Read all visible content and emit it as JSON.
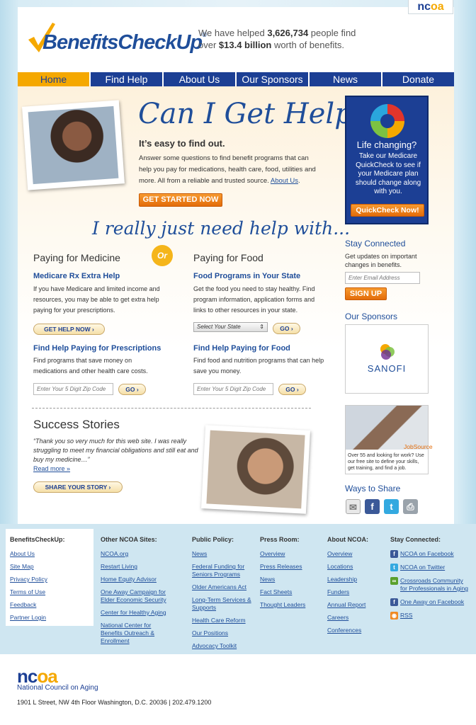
{
  "header": {
    "ncoa_tab": {
      "nc": "nc",
      "oa": "oa"
    },
    "logo_text": "BenefitsCheckUp",
    "logo_reg": "®",
    "helped": {
      "pre": "We have helped ",
      "people": "3,626,734",
      "mid": " people find",
      "line2_pre": "over ",
      "amount": "$13.4 billion",
      "post": " worth of benefits."
    }
  },
  "nav": {
    "items": [
      "Home",
      "Find Help",
      "About Us",
      "Our Sponsors",
      "News",
      "Donate"
    ]
  },
  "hero": {
    "headline": "Can I Get Help?",
    "easy": "It’s easy to find out.",
    "text": "Answer some questions to find benefit programs that can help you pay for medications, health care, food, utilities and more. All from a reliable and trusted source.",
    "about_link": "About Us",
    "cta": "GET STARTED NOW"
  },
  "help": {
    "heading": "I really just need help with...",
    "or": "Or",
    "medicine": {
      "title": "Paying for Medicine",
      "extra_help_title": "Medicare Rx Extra Help",
      "extra_help_text": "If you have Medicare and limited income and resources, you may be able to get extra help paying for your prescriptions.",
      "extra_help_btn": "GET HELP NOW ›",
      "rx_title": "Find Help Paying for Prescriptions",
      "rx_text": "Find programs that save money on medications and other health care costs.",
      "zip_placeholder": "Enter Your 5 Digit Zip Code",
      "go": "GO ›"
    },
    "food": {
      "title": "Paying for Food",
      "programs_title": "Food Programs in Your State",
      "programs_text": "Get the food you need to stay healthy. Find program information, application forms and links to other resources in your state.",
      "state_select": "Select Your State",
      "go": "GO ›",
      "food_title": "Find Help Paying for Food",
      "food_text": "Find food and nutrition programs that can help save you money.",
      "zip_placeholder": "Enter Your 5 Digit Zip Code"
    }
  },
  "success": {
    "title": "Success Stories",
    "quote": "“Thank you so very much for this web site. I was really struggling to meet my financial obligations and still eat and buy my medicine…”",
    "read_more": "Read more »",
    "share_btn": "SHARE YOUR STORY ›"
  },
  "sidebar": {
    "promo": {
      "title": "Life changing?",
      "text": "Take our Medicare QuickCheck to see if your Medicare plan should change along with you.",
      "btn": "QuickCheck Now!"
    },
    "stay_connected": {
      "title": "Stay Connected",
      "text": "Get updates on important changes in benefits.",
      "email_placeholder": "Enter Email Address",
      "signup": "SIGN UP"
    },
    "sponsors": {
      "title": "Our Sponsors",
      "sponsor_name": "SANOFI"
    },
    "jobsource": {
      "label": "JobSource",
      "text": "Over 55 and looking for work? Use our free site to define your skills, get training, and find a job."
    },
    "share": {
      "title": "Ways to Share"
    }
  },
  "footer": {
    "bcu": {
      "title": "BenefitsCheckUp:",
      "links": [
        "About Us",
        "Site Map",
        "Privacy Policy",
        "Terms of Use",
        "Feedback",
        "Partner Login"
      ]
    },
    "other": {
      "title": "Other NCOA Sites:",
      "links": [
        "NCOA.org",
        "Restart Living",
        "Home Equity Advisor",
        "One Away Campaign for Elder Economic Security",
        "Center for Healthy Aging",
        "National Center for Benefits Outreach & Enrollment"
      ]
    },
    "policy": {
      "title": "Public Policy:",
      "links": [
        "News",
        "Federal Funding for Seniors Programs",
        "Older Americans Act",
        "Long-Term Services & Supports",
        "Health Care Reform",
        "Our Positions",
        "Advocacy Toolkit"
      ]
    },
    "press": {
      "title": "Press Room:",
      "links": [
        "Overview",
        "Press Releases",
        "News",
        "Fact Sheets",
        "Thought Leaders"
      ]
    },
    "about": {
      "title": "About NCOA:",
      "links": [
        "Overview",
        "Locations",
        "Leadership",
        "Funders",
        "Annual Report",
        "Careers",
        "Conferences"
      ]
    },
    "connected": {
      "title": "Stay Connected:",
      "links": [
        "NCOA on Facebook",
        "NCOA on Twitter",
        "Crossroads Community for Professionals in Aging",
        "One Away on Facebook",
        "RSS"
      ]
    }
  },
  "bottom": {
    "logo_nc": "nc",
    "logo_oa": "oa",
    "tagline": "National Council on Aging",
    "address": "1901 L Street, NW   4th Floor   Washington, D.C. 20036   |   202.479.1200"
  }
}
